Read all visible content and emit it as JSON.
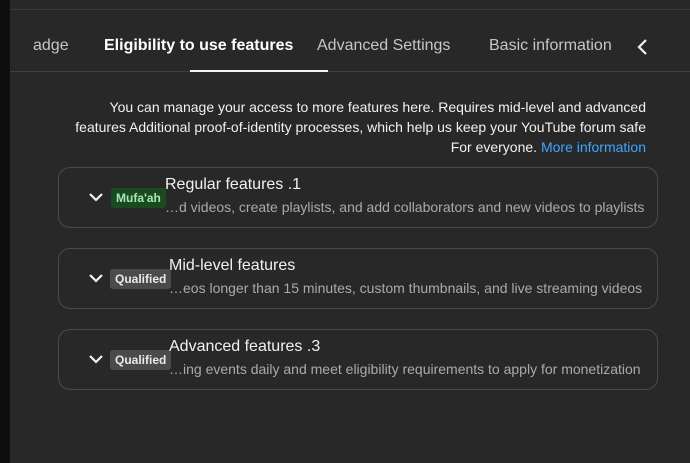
{
  "tabs": [
    {
      "label": "adge",
      "active": false
    },
    {
      "label": "Eligibility to use features",
      "active": true
    },
    {
      "label": "Advanced Settings",
      "active": false
    },
    {
      "label": "Basic information",
      "active": false
    }
  ],
  "description": {
    "line1": "You can manage your access to more features here. Requires mid-level and advanced",
    "line2": "features Additional proof-of-identity processes, which help us keep your YouTube forum safe",
    "line3": "For everyone.",
    "link": "More information"
  },
  "features": [
    {
      "badge": "Mufa'ah",
      "title": "Regular features .1",
      "subtitle": "…d videos, create playlists, and add collaborators and new videos to playlists"
    },
    {
      "badge": "Qualified",
      "title": "Mid-level features",
      "subtitle": "…eos longer than 15 minutes, custom thumbnails, and live streaming videos"
    },
    {
      "badge": "Qualified",
      "title": "Advanced features .3",
      "subtitle": "…ing events daily and meet eligibility requirements to apply for monetization"
    }
  ],
  "colors": {
    "background": "#282828",
    "link": "#3ea6ff",
    "badge_green": "#1b4a22",
    "badge_gray": "#4b4b4b"
  }
}
